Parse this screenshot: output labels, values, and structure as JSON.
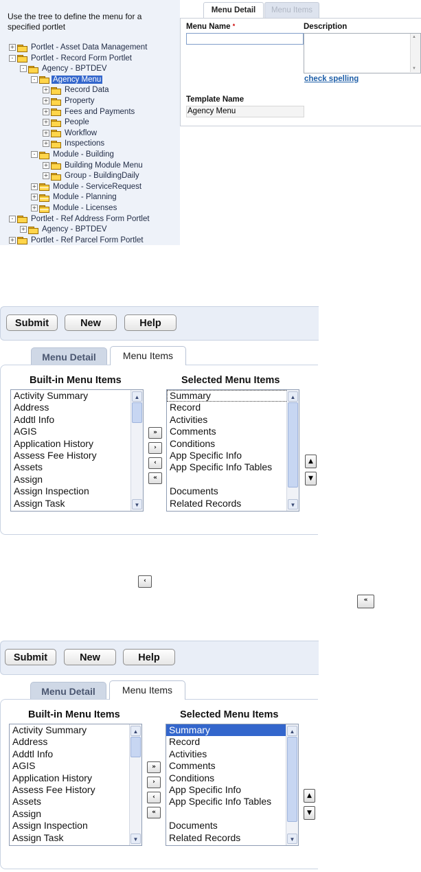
{
  "tree": {
    "intro": "Use the tree to define the menu for a specified portlet",
    "nodes": [
      {
        "label": "Portlet - Asset Data Management",
        "toggle": "+",
        "icon": "folder-icon"
      },
      {
        "label": "Portlet - Record Form Portlet",
        "toggle": "-",
        "icon": "folder-icon"
      },
      {
        "label": "Agency - BPTDEV",
        "toggle": "-",
        "icon": "folder-icon"
      },
      {
        "label": "Agency Menu",
        "toggle": "-",
        "icon": "folder-open-icon",
        "selected": true
      },
      {
        "label": "Record Data",
        "toggle": "+",
        "icon": "folder-icon"
      },
      {
        "label": "Property",
        "toggle": "+",
        "icon": "folder-icon"
      },
      {
        "label": "Fees and Payments",
        "toggle": "+",
        "icon": "folder-icon"
      },
      {
        "label": "People",
        "toggle": "+",
        "icon": "folder-icon"
      },
      {
        "label": "Workflow",
        "toggle": "+",
        "icon": "folder-icon"
      },
      {
        "label": "Inspections",
        "toggle": "+",
        "icon": "folder-icon"
      },
      {
        "label": "Module - Building",
        "toggle": "-",
        "icon": "folder-icon"
      },
      {
        "label": "Building Module Menu",
        "toggle": "+",
        "icon": "folder-open-icon"
      },
      {
        "label": "Group - BuildingDaily",
        "toggle": "+",
        "icon": "user-group-icon"
      },
      {
        "label": "Module - ServiceRequest",
        "toggle": "+",
        "icon": "module-icon"
      },
      {
        "label": "Module - Planning",
        "toggle": "+",
        "icon": "module-icon"
      },
      {
        "label": "Module - Licenses",
        "toggle": "+",
        "icon": "module-icon"
      },
      {
        "label": "Portlet - Ref Address Form Portlet",
        "toggle": "-",
        "icon": "folder-icon"
      },
      {
        "label": "Agency - BPTDEV",
        "toggle": "+",
        "icon": "folder-icon"
      },
      {
        "label": "Portlet - Ref Parcel Form Portlet",
        "toggle": "+",
        "icon": "folder-icon"
      }
    ]
  },
  "detail": {
    "tab_detail": "Menu Detail",
    "tab_items": "Menu Items",
    "menu_name_label": "Menu Name",
    "required_mark": "*",
    "description_label": "Description",
    "check_spelling": "check spelling",
    "template_name_label": "Template Name",
    "template_name_value": "Agency Menu"
  },
  "toolbar": {
    "submit": "Submit",
    "new": "New",
    "help": "Help"
  },
  "items": {
    "tab_detail": "Menu Detail",
    "tab_items": "Menu Items",
    "builtin_header": "Built-in Menu Items",
    "selected_header": "Selected Menu Items",
    "builtin": [
      "Activity Summary",
      "Address",
      "Addtl Info",
      "AGIS",
      "Application History",
      "Assess Fee History",
      "Assets",
      "Assign",
      "Assign Inspection",
      "Assign Task"
    ],
    "selected": [
      "Summary",
      "Record",
      "Activities",
      "Comments",
      "Conditions",
      "App Specific Info",
      "App Specific Info Tables",
      "",
      "Documents",
      "Related Records"
    ]
  },
  "icons": {
    "move_all_right": "»",
    "move_right": "›",
    "move_left": "‹",
    "move_all_left": "«",
    "move_up": "▲",
    "move_down": "▼"
  },
  "colors": {
    "selection": "#3366cc",
    "link": "#1f5fa8",
    "required": "#cc0000"
  }
}
